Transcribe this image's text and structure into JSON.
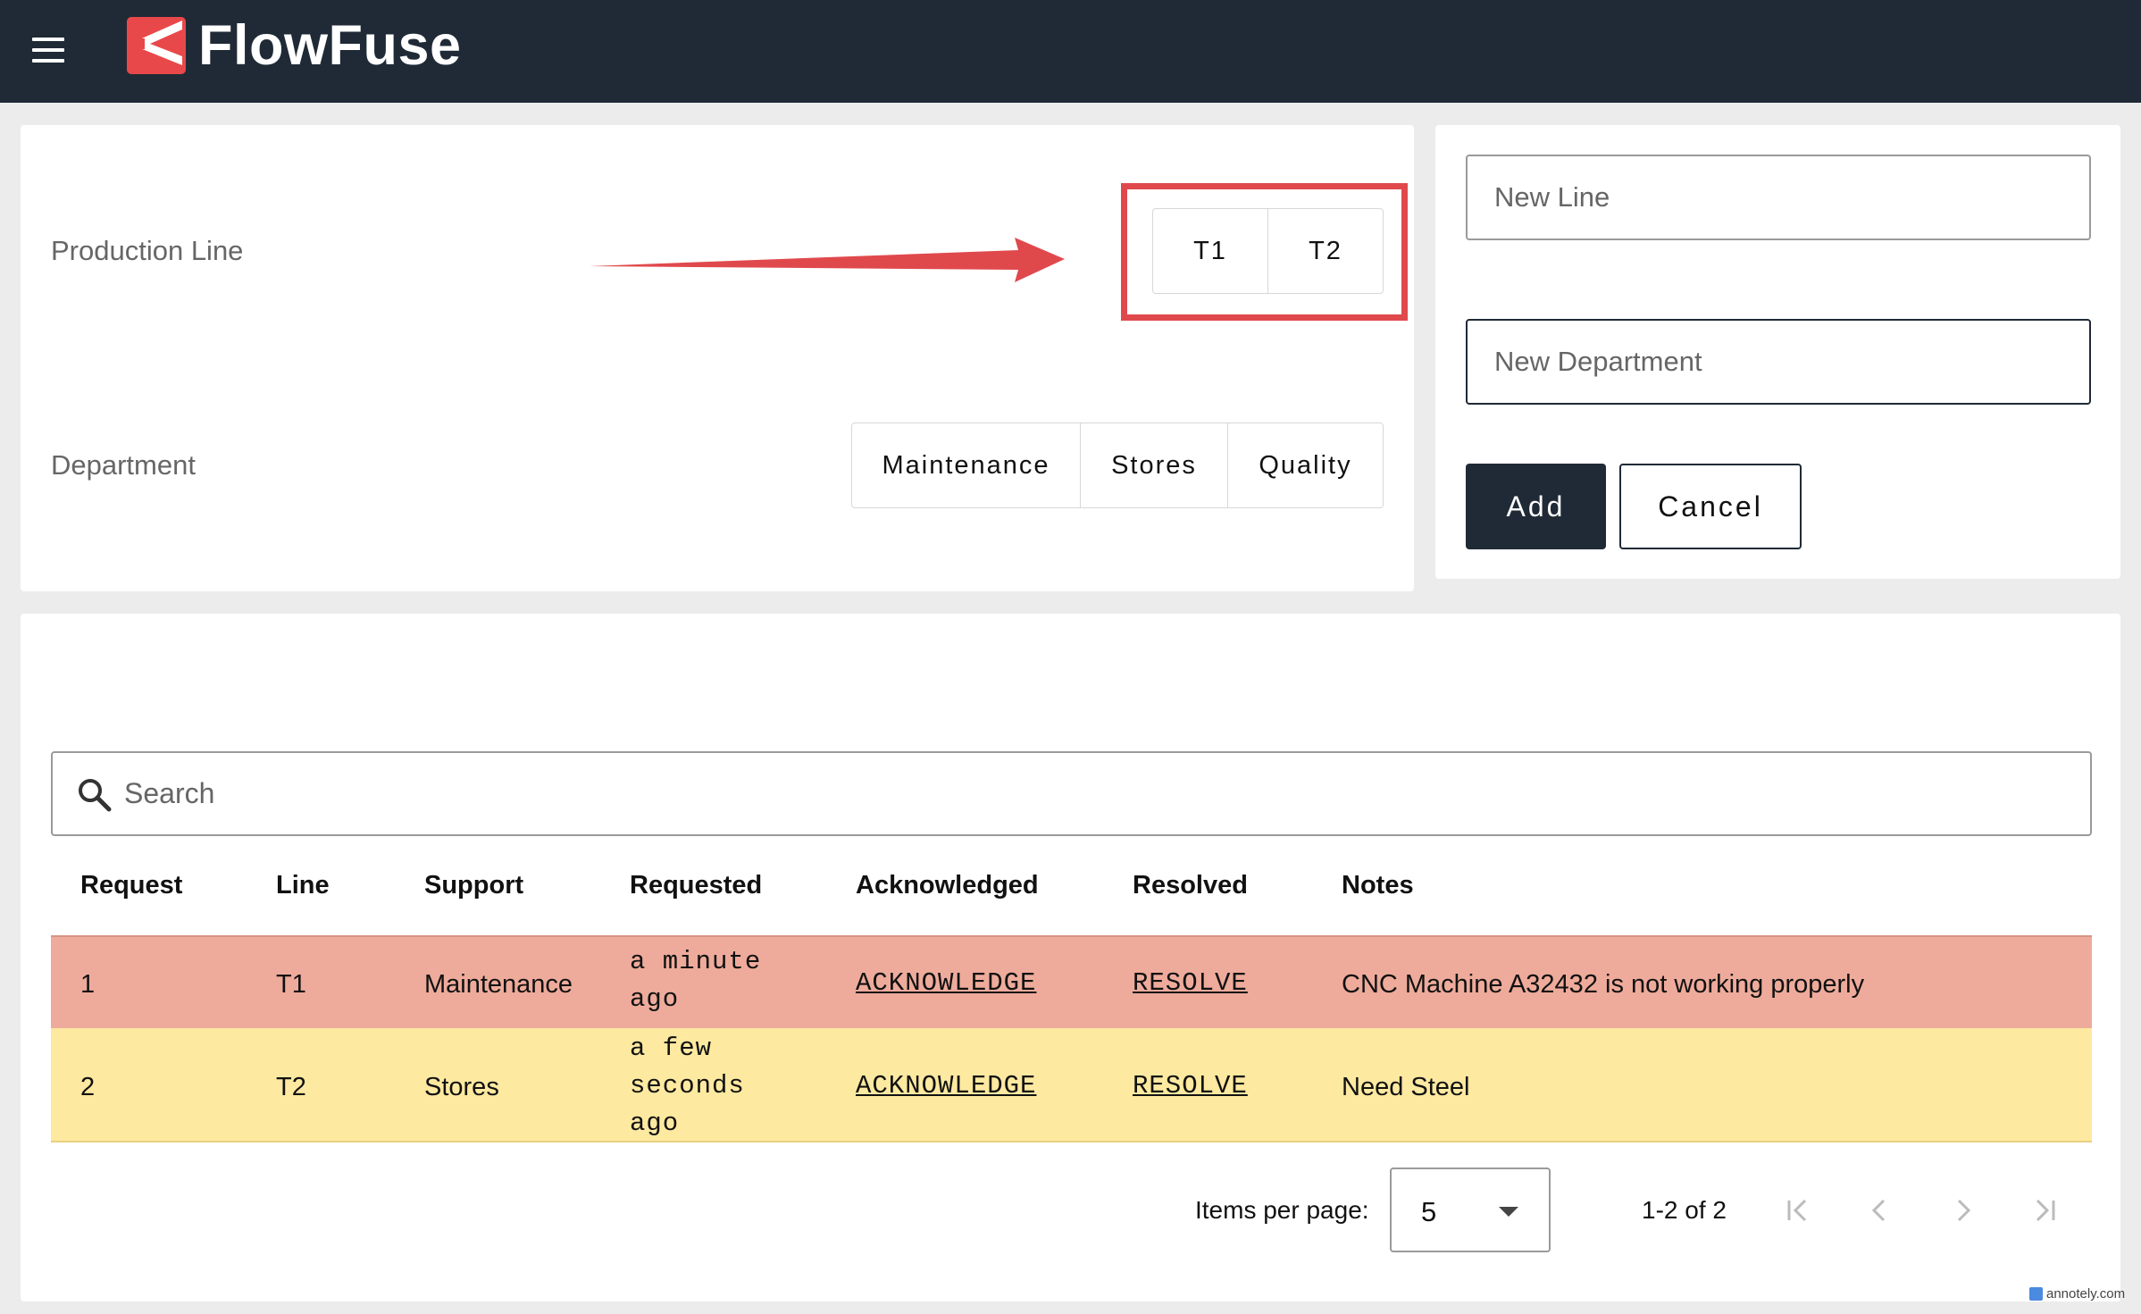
{
  "app": {
    "name": "FlowFuse"
  },
  "production_line": {
    "label": "Production Line",
    "options": [
      "T1",
      "T2"
    ]
  },
  "department": {
    "label": "Department",
    "options": [
      "Maintenance",
      "Stores",
      "Quality"
    ]
  },
  "add_form": {
    "new_line_placeholder": "New Line",
    "new_department_placeholder": "New Department",
    "add_label": "Add",
    "cancel_label": "Cancel"
  },
  "table": {
    "search_placeholder": "Search",
    "columns": [
      "Request",
      "Line",
      "Support",
      "Requested",
      "Acknowledged",
      "Resolved",
      "Notes"
    ],
    "rows": [
      {
        "request": "1",
        "line": "T1",
        "support": "Maintenance",
        "requested": "a minute ago",
        "acknowledged": "ACKNOWLEDGE",
        "resolved": "RESOLVE",
        "notes": "CNC Machine A32432 is not working properly",
        "row_color": "#eeab9b"
      },
      {
        "request": "2",
        "line": "T2",
        "support": "Stores",
        "requested": "a few seconds ago",
        "acknowledged": "ACKNOWLEDGE",
        "resolved": "RESOLVE",
        "notes": "Need Steel",
        "row_color": "#fde9a0"
      }
    ]
  },
  "pagination": {
    "items_per_page_label": "Items per page:",
    "items_per_page_value": "5",
    "range_text": "1-2 of 2"
  },
  "annotation": {
    "arrow_color": "#e0494c"
  },
  "watermark": "annotely.com",
  "colors": {
    "topbar": "#1f2a36",
    "brand": "#e9484a",
    "primary_button": "#1f2a36"
  }
}
